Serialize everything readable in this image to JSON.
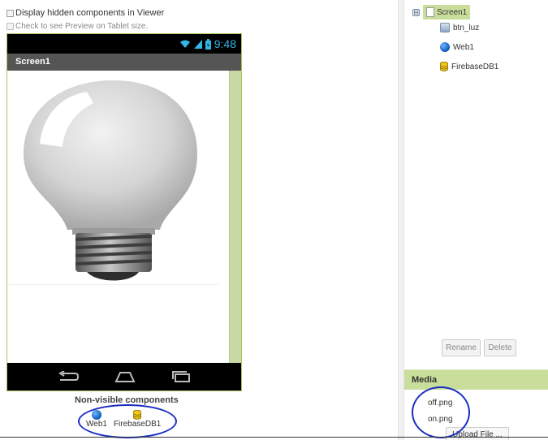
{
  "options": {
    "display_hidden": "Display hidden components in Viewer",
    "tablet_preview": "Check to see Preview on Tablet size."
  },
  "phone": {
    "time": "9:48",
    "screen_title": "Screen1",
    "nav_icons": [
      "back-icon",
      "home-icon",
      "recents-icon"
    ]
  },
  "nonvisible": {
    "title": "Non-visible components",
    "items": [
      {
        "label": "Web1",
        "icon": "web-icon"
      },
      {
        "label": "FirebaseDB1",
        "icon": "database-icon"
      }
    ]
  },
  "components_tree": {
    "root": "Screen1",
    "toggle": "⊟",
    "children": [
      {
        "label": "btn_luz",
        "icon": "button-icon"
      },
      {
        "label": "Web1",
        "icon": "web-icon"
      },
      {
        "label": "FirebaseDB1",
        "icon": "database-icon"
      }
    ],
    "rename_label": "Rename",
    "delete_label": "Delete"
  },
  "media": {
    "title": "Media",
    "files": [
      "off.png",
      "on.png"
    ],
    "upload_label": "Upload File ..."
  },
  "colors": {
    "accent_green": "#c9de9a",
    "annotation_blue": "#1a2fbf",
    "status_blue": "#33b5e5"
  }
}
